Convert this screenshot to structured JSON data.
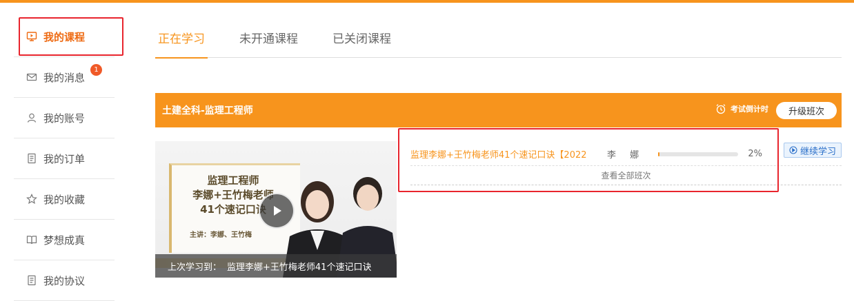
{
  "sidebar": {
    "items": [
      {
        "label": "我的课程",
        "icon": "play-screen-icon",
        "active": true
      },
      {
        "label": "我的消息",
        "icon": "mail-icon",
        "badge": "1"
      },
      {
        "label": "我的账号",
        "icon": "user-icon"
      },
      {
        "label": "我的订单",
        "icon": "document-icon"
      },
      {
        "label": "我的收藏",
        "icon": "star-icon"
      },
      {
        "label": "梦想成真",
        "icon": "book-icon"
      },
      {
        "label": "我的协议",
        "icon": "document-icon"
      }
    ]
  },
  "tabs": [
    {
      "label": "正在学习",
      "active": true
    },
    {
      "label": "未开通课程"
    },
    {
      "label": "已关闭课程"
    }
  ],
  "course": {
    "title": "土建全科-监理工程师",
    "countdown_label": "考试倒计时",
    "upgrade_label": "升级班次",
    "thumbnail": {
      "line1": "监理工程师",
      "line2": "李娜+王竹梅老师",
      "line3": "41个速记口诀",
      "lecturer": "主讲：李娜、王竹梅"
    },
    "last_study_label": "上次学习到：",
    "last_study_value": "监理李娜+王竹梅老师41个速记口诀",
    "lesson": {
      "title": "监理李娜+王竹梅老师41个速记口诀【2022",
      "teacher": "李 娜",
      "progress_percent": 2,
      "progress_text": "2%",
      "continue_label": "继续学习"
    },
    "view_all_label": "查看全部班次"
  },
  "colors": {
    "accent": "#f7941d",
    "active_text": "#ee6a12",
    "highlight_border": "#e8242d",
    "badge": "#f05a28",
    "continue_blue": "#2a6fc9"
  }
}
